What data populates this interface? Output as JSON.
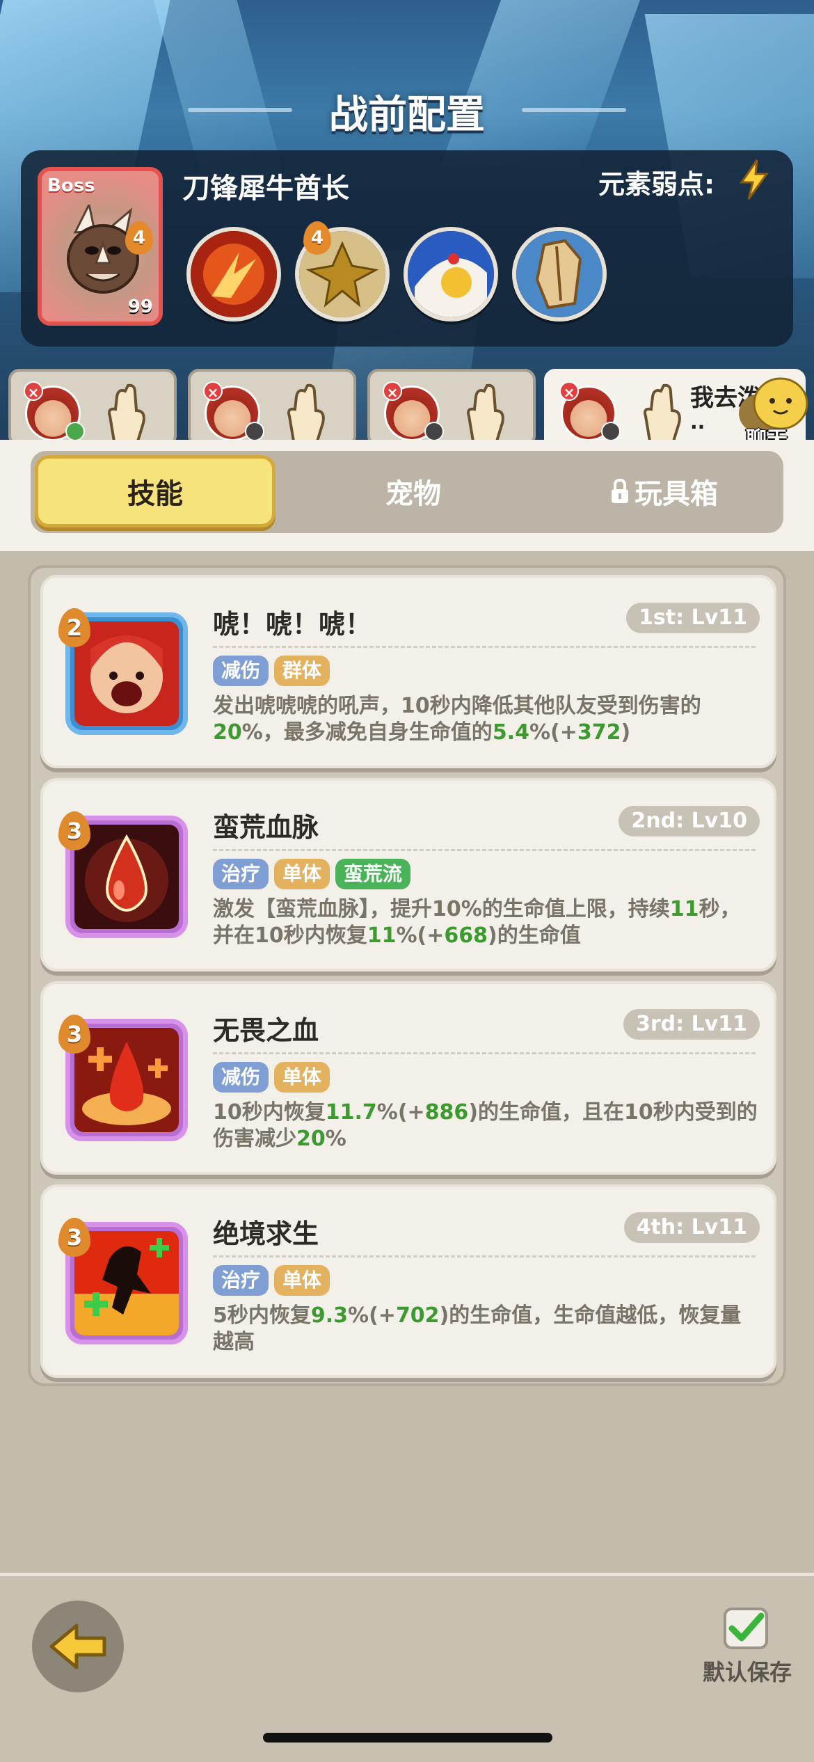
{
  "header": {
    "title": "战前配置"
  },
  "boss": {
    "tag": "Boss",
    "name": "刀锋犀牛酋长",
    "level": "99",
    "weakness_label": "元素弱点:",
    "weakness_icon": "lightning-icon",
    "skills": [
      {
        "icon": "fire-claw-icon",
        "badge": "4"
      },
      {
        "icon": "gold-spike-icon",
        "badge": "4"
      },
      {
        "icon": "shield-hero-icon",
        "badge": ""
      },
      {
        "icon": "stone-armor-icon",
        "badge": ""
      }
    ]
  },
  "party": {
    "slots": [
      {
        "status": "green"
      },
      {
        "status": "gray"
      },
      {
        "status": "gray"
      },
      {
        "status": "gray",
        "text": "我去泼",
        "text2": ".."
      }
    ],
    "chat_label": "聊天"
  },
  "tabs": {
    "skills": "技能",
    "pets": "宠物",
    "toybox": "玩具箱"
  },
  "skills": [
    {
      "badge": "2",
      "name": "唬！唬！唬！",
      "rank": "1st: Lv11",
      "frame": "blue",
      "tags": [
        {
          "text": "减伤",
          "color": "blue"
        },
        {
          "text": "群体",
          "color": "orange"
        }
      ],
      "desc": [
        {
          "t": "发出唬唬唬的吼声，10秒内降低其他队友受到伤害的"
        },
        {
          "t": "20",
          "g": true
        },
        {
          "t": "%，最多减免自身生命值的"
        },
        {
          "t": "5.4",
          "g": true
        },
        {
          "t": "%(+"
        },
        {
          "t": "372",
          "g": true
        },
        {
          "t": ")"
        }
      ]
    },
    {
      "badge": "3",
      "name": "蛮荒血脉",
      "rank": "2nd: Lv10",
      "frame": "purple",
      "tags": [
        {
          "text": "治疗",
          "color": "blue"
        },
        {
          "text": "单体",
          "color": "orange"
        },
        {
          "text": "蛮荒流",
          "color": "green"
        }
      ],
      "desc": [
        {
          "t": "激发【蛮荒血脉】，提升10%的生命值上限，持续"
        },
        {
          "t": "11",
          "g": true
        },
        {
          "t": "秒，并在10秒内恢复"
        },
        {
          "t": "11",
          "g": true
        },
        {
          "t": "%(+"
        },
        {
          "t": "668",
          "g": true
        },
        {
          "t": ")的生命值"
        }
      ]
    },
    {
      "badge": "3",
      "name": "无畏之血",
      "rank": "3rd: Lv11",
      "frame": "purple",
      "tags": [
        {
          "text": "减伤",
          "color": "blue"
        },
        {
          "text": "单体",
          "color": "orange"
        }
      ],
      "desc": [
        {
          "t": "10秒内恢复"
        },
        {
          "t": "11.7",
          "g": true
        },
        {
          "t": "%(+"
        },
        {
          "t": "886",
          "g": true
        },
        {
          "t": ")的生命值，且在10秒内受到的伤害减少"
        },
        {
          "t": "20",
          "g": true
        },
        {
          "t": "%"
        }
      ]
    },
    {
      "badge": "3",
      "name": "绝境求生",
      "rank": "4th: Lv11",
      "frame": "purple",
      "tags": [
        {
          "text": "治疗",
          "color": "blue"
        },
        {
          "text": "单体",
          "color": "orange"
        }
      ],
      "desc": [
        {
          "t": "5秒内恢复"
        },
        {
          "t": "9.3",
          "g": true
        },
        {
          "t": "%(+"
        },
        {
          "t": "702",
          "g": true
        },
        {
          "t": ")的生命值，生命值越低，恢复量越高"
        }
      ]
    }
  ],
  "footer": {
    "save_label": "默认保存",
    "save_checked": true
  },
  "colors": {
    "tab_active": "#f7e37c",
    "accent_green": "#3c9a2e",
    "tag_blue": "#7f9fd4",
    "tag_orange": "#e4b25e",
    "tag_green": "#4ab35a"
  }
}
